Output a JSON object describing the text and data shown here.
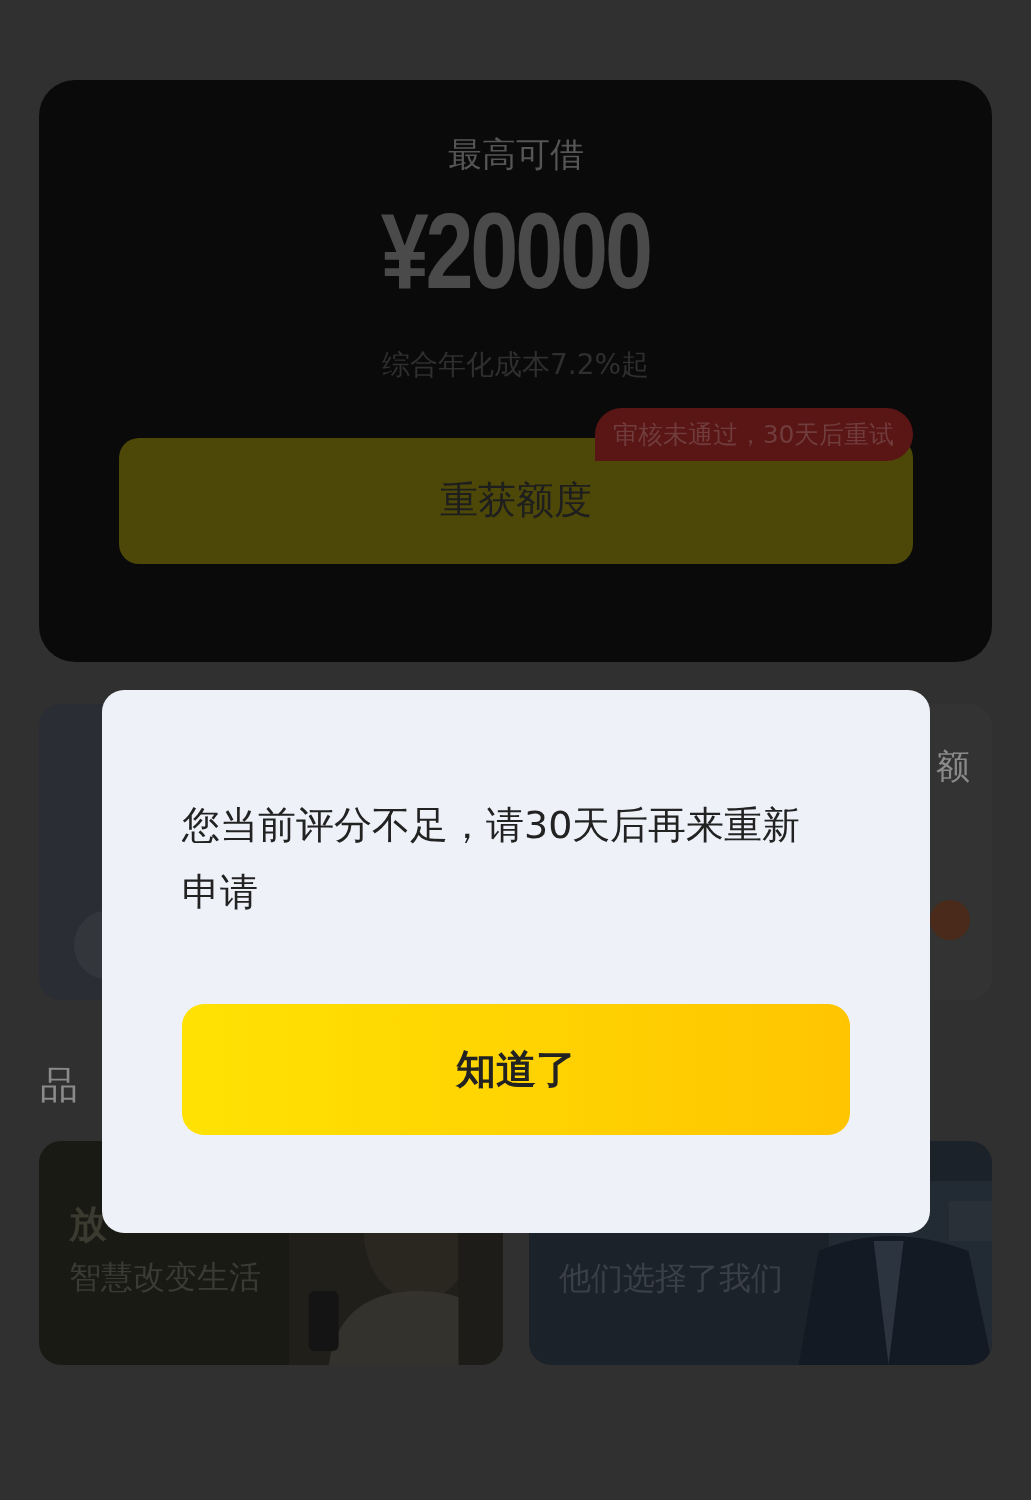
{
  "credit_card": {
    "label": "最高可借",
    "amount": "¥20000",
    "rate": "综合年化成本7.2%起",
    "button": "重获额度",
    "badge": "审核未通过，30天后重试"
  },
  "feature_card": {
    "title": "额"
  },
  "section_title": "品",
  "brand_cards": [
    {
      "title": "放",
      "subtitle": "智慧改变生活",
      "kind": "picture"
    },
    {
      "subtitle": "他们选择了我们",
      "kind": "picture"
    }
  ],
  "dialog": {
    "message": "您当前评分不足，请30天后再来重新申请",
    "button": "知道了"
  }
}
